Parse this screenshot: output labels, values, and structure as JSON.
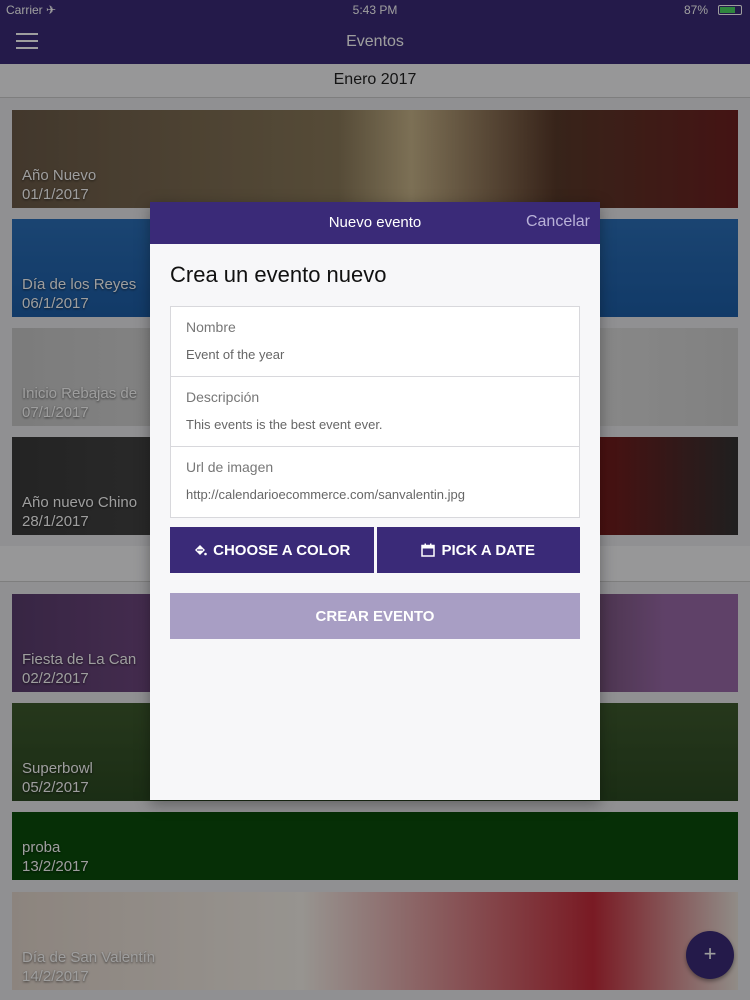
{
  "status_bar": {
    "carrier": "Carrier ✈",
    "time": "5:43 PM",
    "battery": "87%"
  },
  "navbar": {
    "title": "Eventos",
    "menu_icon": "hamburger-icon"
  },
  "months": [
    "Enero 2017",
    ""
  ],
  "events": [
    {
      "name": "Año Nuevo",
      "date": "01/1/2017"
    },
    {
      "name": "Día de los Reyes",
      "date": "06/1/2017"
    },
    {
      "name": "Inicio Rebajas de",
      "date": "07/1/2017"
    },
    {
      "name": "Año nuevo Chino",
      "date": "28/1/2017"
    },
    {
      "name": "Fiesta de La Can",
      "date": "02/2/2017"
    },
    {
      "name": "Superbowl",
      "date": "05/2/2017"
    },
    {
      "name": "proba",
      "date": "13/2/2017"
    },
    {
      "name": "Día de San Valentín",
      "date": "14/2/2017"
    }
  ],
  "fab": {
    "label": "+"
  },
  "modal": {
    "title": "Nuevo evento",
    "cancel": "Cancelar",
    "heading": "Crea un evento nuevo",
    "fields": [
      {
        "label": "Nombre",
        "value": "Event of the year"
      },
      {
        "label": "Descripción",
        "value": "This events is the best event ever."
      },
      {
        "label": "Url de imagen",
        "value": "http://calendarioecommerce.com/sanvalentin.jpg"
      }
    ],
    "color_button": "CHOOSE A COLOR",
    "date_button": "PICK A DATE",
    "create_button": "CREAR EVENTO"
  },
  "colors": {
    "primary": "#3a2a78",
    "create_disabled": "#a89ec4",
    "accent_cancel": "#b9b2d8"
  }
}
